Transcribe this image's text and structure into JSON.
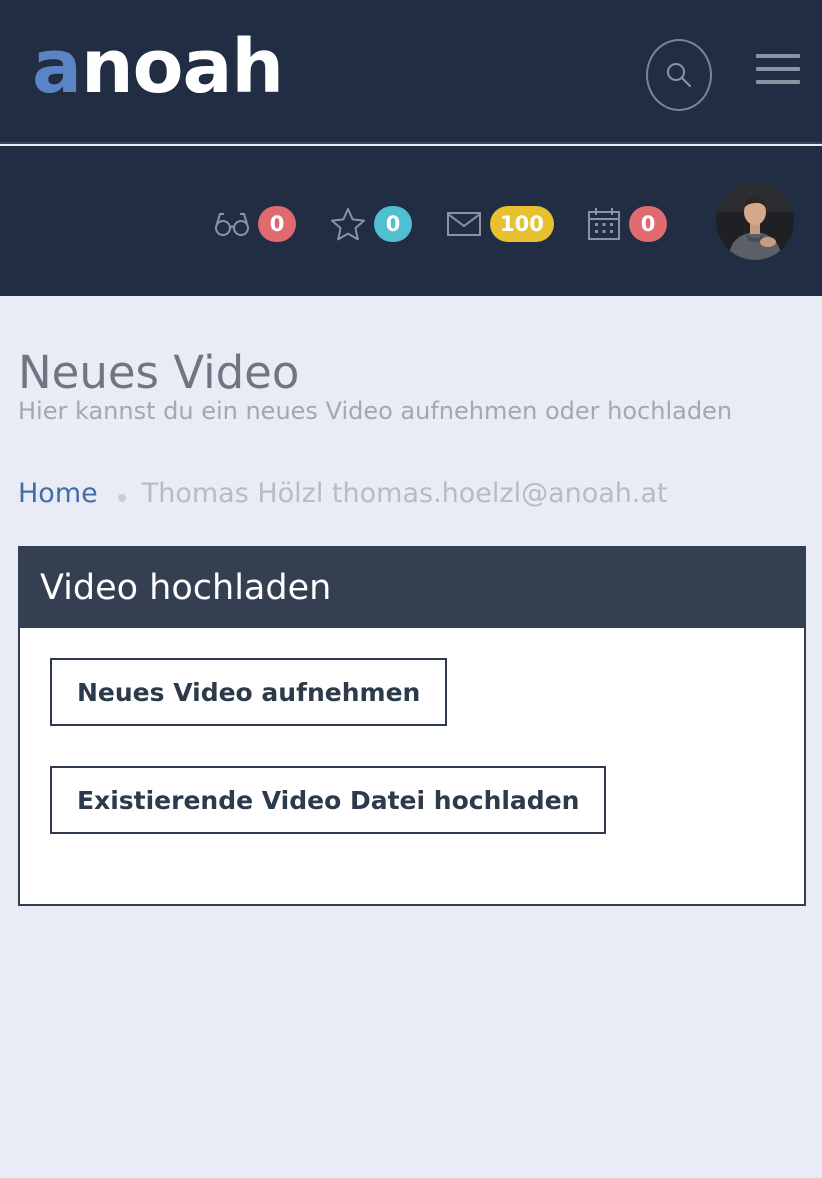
{
  "header": {
    "logo_accent": "a",
    "logo_rest": "noah"
  },
  "stats": [
    {
      "icon": "glasses-icon",
      "count": "0",
      "color": "#e06b6f"
    },
    {
      "icon": "star-icon",
      "count": "0",
      "color": "#4fbfd1"
    },
    {
      "icon": "mail-icon",
      "count": "100",
      "color": "#e8c12e"
    },
    {
      "icon": "calendar-icon",
      "count": "0",
      "color": "#e06b6f"
    }
  ],
  "page": {
    "title": "Neues Video",
    "subtitle": "Hier kannst du ein neues Video aufnehmen oder hochladen"
  },
  "breadcrumb": {
    "home": "Home",
    "current": "Thomas Hölzl thomas.hoelzl@anoah.at"
  },
  "panel": {
    "title": "Video hochladen",
    "record_button": "Neues Video aufnehmen",
    "upload_button": "Existierende Video Datei hochladen"
  },
  "colors": {
    "header_bg": "#212d42",
    "panel_header_bg": "#343f52",
    "page_bg": "#e9ecf4",
    "link": "#3f6fa8",
    "logo_accent": "#5b84c6"
  }
}
